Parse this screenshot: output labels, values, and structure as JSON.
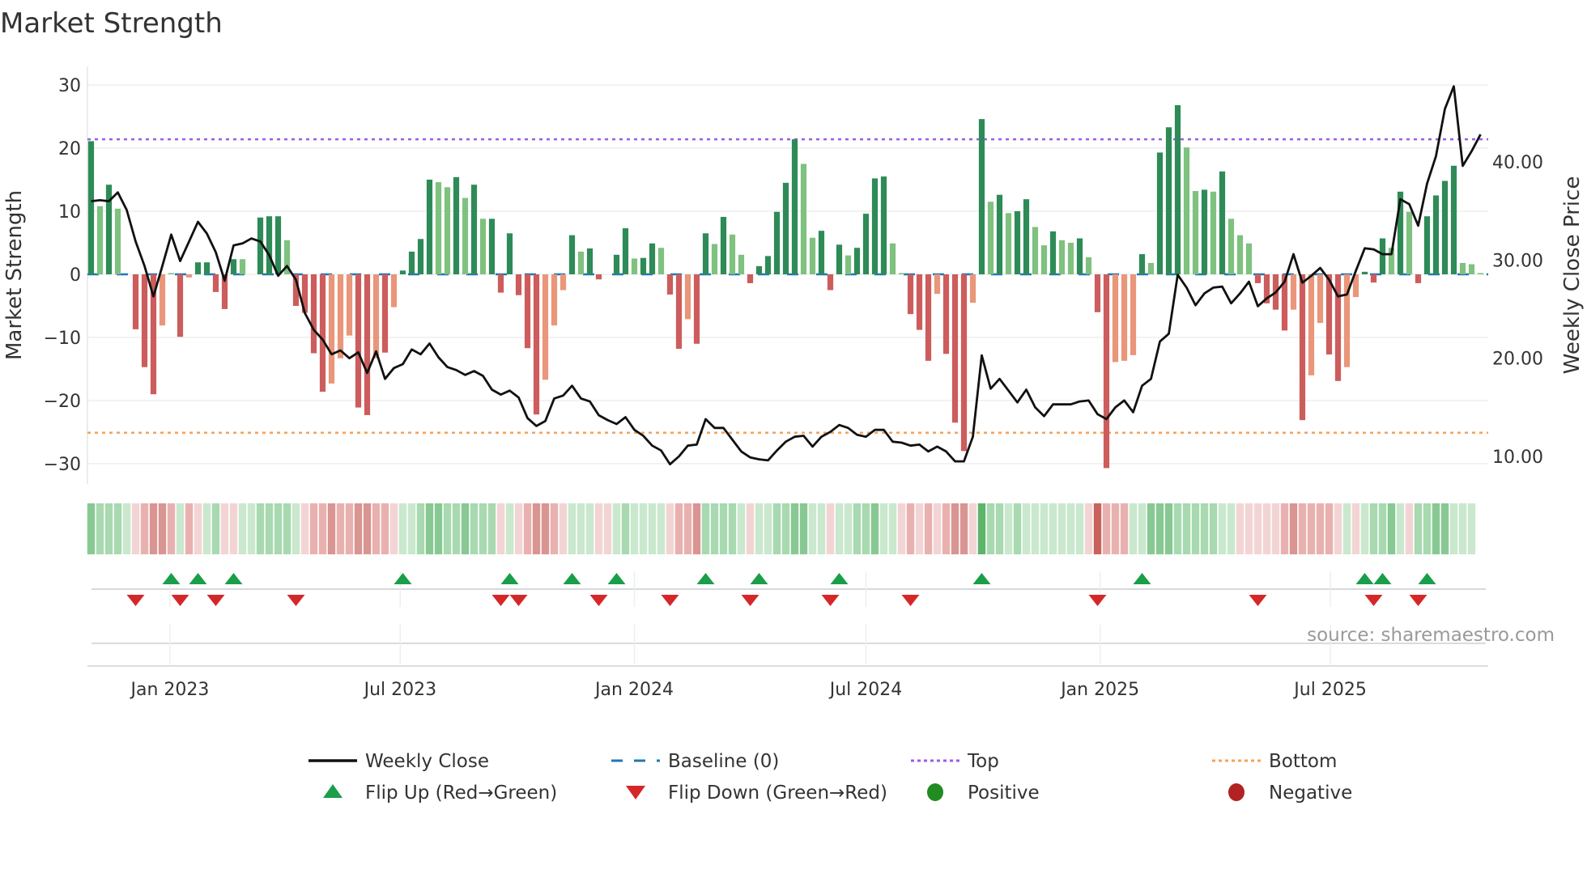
{
  "title": "Market Strength",
  "source": "source: sharemaestro.com",
  "chart_data": {
    "type": "bar",
    "title": "Market Strength",
    "x_start_week": "2022-10-31",
    "x_interval": "weekly",
    "ylabel": "Market Strength",
    "y2label": "Weekly Close Price",
    "ylim": [
      -33,
      33
    ],
    "y2lim": [
      8,
      50
    ],
    "yticks": [
      30,
      20,
      10,
      0,
      -10,
      -20,
      -30
    ],
    "yticklabels": [
      "30",
      "20",
      "10",
      "0",
      "−10",
      "−20",
      "−30"
    ],
    "y2ticks": [
      40,
      30,
      20,
      10
    ],
    "y2ticklabels": [
      "40.00",
      "30.00",
      "20.00",
      "10.00"
    ],
    "xticks": [
      {
        "date": "2023-01-01",
        "label": "Jan 2023"
      },
      {
        "date": "2023-07-01",
        "label": "Jul 2023"
      },
      {
        "date": "2024-01-01",
        "label": "Jan 2024"
      },
      {
        "date": "2024-07-01",
        "label": "Jul 2024"
      },
      {
        "date": "2025-01-01",
        "label": "Jan 2025"
      },
      {
        "date": "2025-07-01",
        "label": "Jul 2025"
      }
    ],
    "top_level": 21.4,
    "bottom_level": -25.1,
    "baseline": 0,
    "strength": [
      21.1,
      10.8,
      14.2,
      10.4,
      0,
      -8.7,
      -14.7,
      -19,
      -8.1,
      0.2,
      -9.9,
      -0.5,
      1.9,
      1.9,
      -2.8,
      -5.5,
      2.4,
      2.4,
      0,
      9.0,
      9.2,
      9.2,
      5.4,
      -5,
      -6.1,
      -12.5,
      -18.6,
      -17.3,
      -13.3,
      -9.7,
      -21.1,
      -22.3,
      -13.3,
      -12.4,
      -5.2,
      0.6,
      3.6,
      5.6,
      15,
      14.6,
      13.8,
      15.4,
      12.1,
      14.2,
      8.8,
      8.8,
      -2.9,
      6.5,
      -3.3,
      -11.7,
      -22.2,
      -16.7,
      -8.1,
      -2.5,
      6.2,
      3.6,
      4.1,
      -0.8,
      0,
      3.1,
      7.3,
      2.5,
      2.6,
      4.9,
      4.2,
      -3.2,
      -11.8,
      -7.1,
      -11,
      6.5,
      4.8,
      9.1,
      6.3,
      3.1,
      -1.4,
      1.3,
      2.9,
      9.9,
      14.5,
      21.4,
      17.5,
      5.8,
      6.9,
      -2.5,
      4.7,
      3,
      4.2,
      9.6,
      15.2,
      15.5,
      4.9,
      0.2,
      -6.3,
      -8.8,
      -13.7,
      -3.1,
      -12.6,
      -23.5,
      -28,
      -4.5,
      24.6,
      11.5,
      12.6,
      9.7,
      10,
      11.9,
      7.5,
      4.6,
      6.8,
      5.4,
      5,
      5.7,
      2.7,
      -6,
      -30.7,
      -13.9,
      -13.7,
      -12.8,
      3.2,
      1.8,
      19.3,
      23.3,
      26.8,
      20.1,
      13.2,
      13.4,
      13.1,
      16.3,
      8.8,
      6.2,
      4.9,
      -1.4,
      -4.6,
      -5.6,
      -8.9,
      -5.6,
      -23.1,
      -16,
      -7.7,
      -12.7,
      -16.9,
      -14.7,
      -3.6,
      0.4,
      -1.3,
      5.7,
      4.2,
      13.1,
      9.9,
      -1.4,
      9.2,
      12.5,
      14.8,
      17.2,
      1.8,
      1.6,
      0.2
    ],
    "strength_tone": "GgGgGRRRrgRrGGRRGggGGGgRRRRrrrRRrRrGGGGggGgGgGRGRRRrrrGgGRGGGgGGgRRrRGgGggRGGGGGggGRGgGGGGggRRRrRRRrGgGgGGggGggGgRRrrrGgGGGggGgGgggRRRRrRrrRRrrGRGgGgRGGGGggg",
    "weekly_close": [
      36.0,
      36.1,
      36.0,
      36.9,
      35.1,
      31.9,
      29.4,
      26.3,
      29.4,
      32.6,
      29.9,
      31.9,
      33.9,
      32.7,
      30.8,
      27.9,
      31.5,
      31.7,
      32.2,
      31.9,
      30.5,
      28.4,
      29.4,
      28,
      24.6,
      22.9,
      21.9,
      20.4,
      20.8,
      20,
      20.6,
      18.5,
      20.7,
      17.9,
      19,
      19.4,
      20.9,
      20.4,
      21.5,
      20.1,
      19.1,
      18.8,
      18.3,
      18.7,
      18.2,
      16.8,
      16.3,
      16.7,
      16,
      13.9,
      13.1,
      13.6,
      15.9,
      16.2,
      17.2,
      15.9,
      15.6,
      14.2,
      13.7,
      13.3,
      14,
      12.7,
      12.1,
      11.1,
      10.6,
      9.2,
      10,
      11.1,
      11.2,
      13.8,
      12.9,
      12.9,
      11.7,
      10.5,
      9.9,
      9.7,
      9.6,
      10.6,
      11.5,
      12,
      12.1,
      11,
      12,
      12.5,
      13.2,
      12.9,
      12.2,
      12,
      12.7,
      12.7,
      11.5,
      11.4,
      11.1,
      11.2,
      10.5,
      11,
      10.5,
      9.5,
      9.5,
      12,
      20.3,
      16.9,
      17.9,
      16.7,
      15.5,
      16.8,
      15,
      14.1,
      15.3,
      15.3,
      15.3,
      15.6,
      15.7,
      14.3,
      13.8,
      15,
      15.7,
      14.5,
      17.2,
      17.9,
      21.7,
      22.5,
      28.5,
      27.2,
      25.4,
      26.6,
      27.2,
      27.3,
      25.6,
      26.6,
      27.8,
      25.3,
      26.1,
      26.7,
      27.8,
      30.6,
      27.7,
      28.4,
      29.2,
      28,
      26.3,
      26.5,
      28.9,
      31.2,
      31.1,
      30.6,
      30.6,
      36.2,
      35.7,
      33.5,
      37.8,
      40.6,
      45.4,
      47.7,
      39.6,
      41.1,
      42.8
    ],
    "heat": [
      3,
      2,
      2,
      2,
      1,
      -1,
      -2,
      -3,
      -3,
      -2,
      1,
      -2,
      -1,
      1,
      2,
      -1,
      -1,
      1,
      1,
      2,
      2,
      2,
      2,
      1,
      -1,
      -2,
      -2,
      -3,
      -2,
      -2,
      -3,
      -3,
      -2,
      -2,
      -1,
      1,
      1,
      2,
      3,
      3,
      2,
      2,
      3,
      2,
      2,
      2,
      -1,
      1,
      -1,
      -2,
      -3,
      -3,
      -2,
      -1,
      1,
      1,
      1,
      -1,
      -1,
      1,
      2,
      1,
      1,
      1,
      1,
      -1,
      -2,
      -2,
      -3,
      2,
      2,
      2,
      2,
      1,
      -1,
      1,
      1,
      2,
      2,
      3,
      3,
      1,
      1,
      -1,
      1,
      1,
      2,
      2,
      3,
      1,
      1,
      -1,
      -2,
      -1,
      -2,
      -1,
      -2,
      -3,
      -3,
      -1,
      4,
      2,
      2,
      1,
      2,
      1,
      1,
      1,
      1,
      1,
      1,
      1,
      -1,
      -4,
      -2,
      -2,
      -2,
      1,
      1,
      3,
      3,
      3,
      2,
      2,
      2,
      2,
      2,
      1,
      1,
      -1,
      -1,
      -1,
      -1,
      -1,
      -2,
      -3,
      -2,
      -2,
      -2,
      -2,
      -1,
      1,
      -1,
      1,
      2,
      2,
      3,
      1,
      -1,
      2,
      2,
      3,
      3,
      1,
      1,
      1
    ],
    "flip_up_weeks": [
      9,
      12,
      16,
      35,
      47,
      54,
      59,
      69,
      75,
      84,
      100,
      118,
      143,
      145,
      150
    ],
    "flip_down_weeks": [
      5,
      10,
      14,
      23,
      46,
      48,
      57,
      65,
      74,
      83,
      92,
      113,
      131,
      144,
      149
    ],
    "legend": [
      {
        "label": "Weekly Close",
        "kind": "line"
      },
      {
        "label": "Baseline (0)",
        "kind": "dash"
      },
      {
        "label": "Top",
        "kind": "dot-top"
      },
      {
        "label": "Bottom",
        "kind": "dot-bottom"
      },
      {
        "label": "Flip Up (Red→Green)",
        "kind": "tri-up"
      },
      {
        "label": "Flip Down (Green→Red)",
        "kind": "tri-down"
      },
      {
        "label": "Positive",
        "kind": "circle-pos"
      },
      {
        "label": "Negative",
        "kind": "circle-neg"
      }
    ],
    "legend_placement": "bottom"
  },
  "colors": {
    "green_dark": "#2e8b57",
    "green_light": "#7fc17f",
    "red": "#cd5c5c",
    "salmon": "#e9967a",
    "line": "#111111",
    "baseline": "#1f77b4",
    "top": "#9b5de5",
    "bottom": "#f4a259",
    "flip_up": "#1a9e4a",
    "flip_down": "#d62728",
    "positive": "#228b22",
    "negative": "#b22222"
  }
}
